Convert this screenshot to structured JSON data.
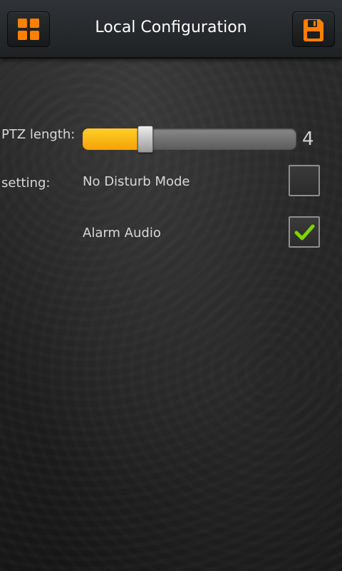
{
  "header": {
    "title": "Local Configuration",
    "left_icon": "grid-menu-icon",
    "right_icon": "save-disk-icon",
    "accent_color": "#ff7f00"
  },
  "ptz": {
    "label": "PTZ length:",
    "value_text": "4",
    "fill_percent": 29
  },
  "settings": {
    "label": "setting:",
    "options": [
      {
        "label": "No Disturb Mode",
        "checked": false
      },
      {
        "label": "Alarm Audio",
        "checked": true
      }
    ]
  }
}
